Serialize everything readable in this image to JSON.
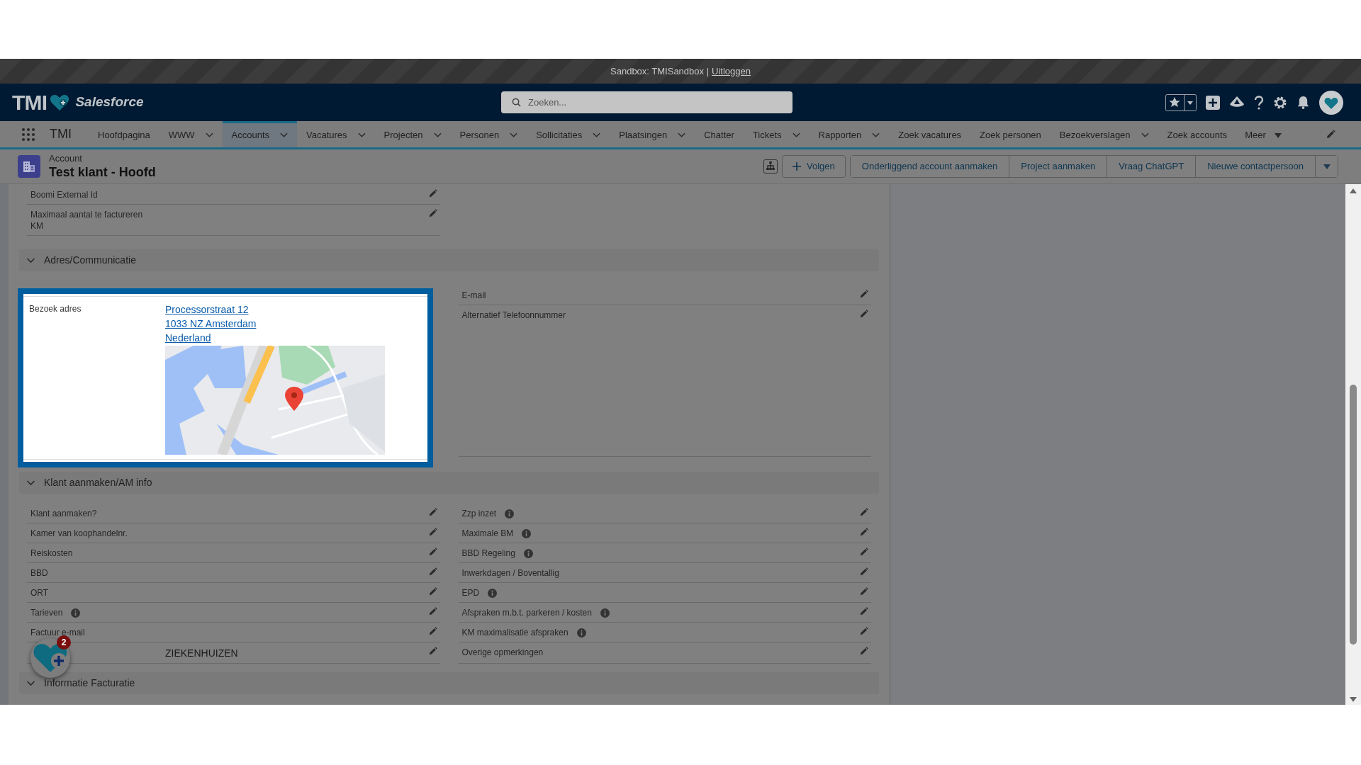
{
  "banner": {
    "text": "Sandbox: TMISandbox |",
    "link": "Uitloggen"
  },
  "header": {
    "logo_text": "TMI",
    "brand": "Salesforce",
    "search": {
      "placeholder": "Zoeken..."
    }
  },
  "nav": {
    "app_name": "TMI",
    "items": [
      {
        "label": "Hoofdpagina",
        "dropdown": false,
        "selected": false
      },
      {
        "label": "WWW",
        "dropdown": true,
        "selected": false
      },
      {
        "label": "Accounts",
        "dropdown": true,
        "selected": true
      },
      {
        "label": "Vacatures",
        "dropdown": true,
        "selected": false
      },
      {
        "label": "Projecten",
        "dropdown": true,
        "selected": false
      },
      {
        "label": "Personen",
        "dropdown": true,
        "selected": false
      },
      {
        "label": "Sollicitaties",
        "dropdown": true,
        "selected": false
      },
      {
        "label": "Plaatsingen",
        "dropdown": true,
        "selected": false
      },
      {
        "label": "Chatter",
        "dropdown": false,
        "selected": false
      },
      {
        "label": "Tickets",
        "dropdown": true,
        "selected": false
      },
      {
        "label": "Rapporten",
        "dropdown": true,
        "selected": false
      },
      {
        "label": "Zoek vacatures",
        "dropdown": false,
        "selected": false
      },
      {
        "label": "Zoek personen",
        "dropdown": false,
        "selected": false
      },
      {
        "label": "Bezoekverslagen",
        "dropdown": true,
        "selected": false
      },
      {
        "label": "Zoek accounts",
        "dropdown": false,
        "selected": false
      }
    ],
    "more": "Meer"
  },
  "record": {
    "object": "Account",
    "title": "Test klant - Hoofd",
    "follow": "Volgen",
    "actions": [
      "Onderliggend account aanmaken",
      "Project aanmaken",
      "Vraag ChatGPT",
      "Nieuwe contactpersoon"
    ]
  },
  "top_fields": [
    {
      "label": "Boomi External Id"
    },
    {
      "label": "Maximaal aantal te factureren KM"
    }
  ],
  "address_section": {
    "title": "Adres/Communicatie",
    "expanded": true,
    "highlight": {
      "label": "Bezoek adres",
      "address_lines": [
        "Processorstraat 12",
        "1033 NZ Amsterdam",
        "Nederland"
      ],
      "map": {
        "kind": "picture"
      }
    },
    "right_fields": [
      {
        "label": "E-mail"
      },
      {
        "label": "Alternatief Telefoonnummer"
      }
    ]
  },
  "klant_section": {
    "title": "Klant aanmaken/AM info",
    "expanded": true,
    "rows": [
      {
        "left": {
          "label": "Klant aanmaken?",
          "info": false
        },
        "right": {
          "label": "Zzp inzet",
          "info": true
        }
      },
      {
        "left": {
          "label": "Kamer van koophandelnr.",
          "info": false
        },
        "right": {
          "label": "Maximale BM",
          "info": true
        }
      },
      {
        "left": {
          "label": "Reiskosten",
          "info": false
        },
        "right": {
          "label": "BBD Regeling",
          "info": true
        }
      },
      {
        "left": {
          "label": "BBD",
          "info": false
        },
        "right": {
          "label": "Inwerkdagen / Boventallig",
          "info": false
        }
      },
      {
        "left": {
          "label": "ORT",
          "info": false
        },
        "right": {
          "label": "EPD",
          "info": true
        }
      },
      {
        "left": {
          "label": "Tarieven",
          "info": true
        },
        "right": {
          "label": "Afspraken m.b.t. parkeren / kosten",
          "info": true
        }
      },
      {
        "left": {
          "label": "Factuur e-mail",
          "info": false
        },
        "right": {
          "label": "KM maximalisatie afspraken",
          "info": true
        }
      },
      {
        "left": {
          "value": "ZIEKENHUIZEN",
          "info": false
        },
        "right": {
          "label": "Overige opmerkingen",
          "info": false
        }
      }
    ]
  },
  "billing_section": {
    "title": "Informatie Facturatie",
    "expanded": true
  },
  "widget": {
    "badge": "2"
  }
}
